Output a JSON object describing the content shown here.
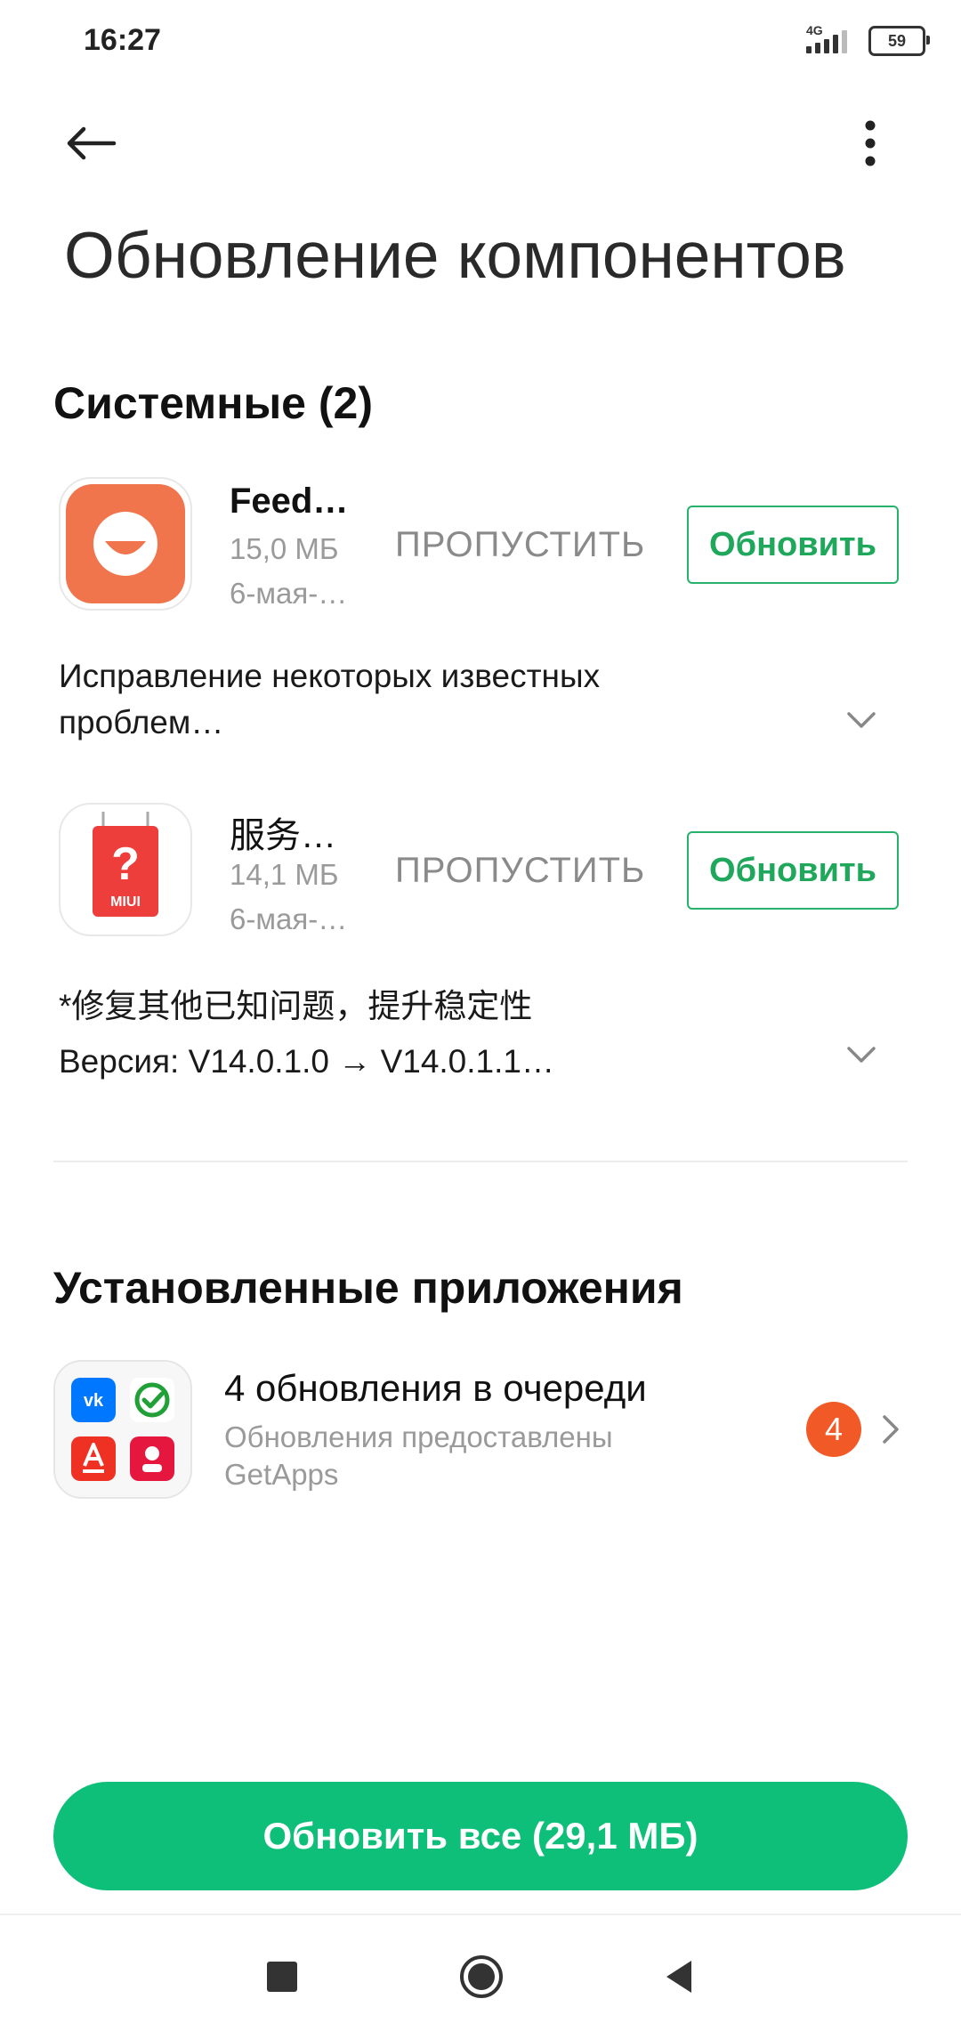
{
  "status_bar": {
    "time": "16:27",
    "network": "4G",
    "battery": "59"
  },
  "header": {
    "title": "Обновление компонентов"
  },
  "system_section": {
    "heading": "Системные (2)",
    "items": [
      {
        "name": "Feed…",
        "size": "15,0 МБ",
        "date": "6-мая-…",
        "skip_label": "ПРОПУСТИТЬ",
        "update_label": "Обновить",
        "description_line1": "Исправление некоторых известных",
        "description_line2": "проблем…",
        "icon": "feed-smile-icon",
        "icon_color": "#F0744C"
      },
      {
        "name": "服务…",
        "size": "14,1 МБ",
        "date": "6-мая-…",
        "skip_label": "ПРОПУСТИТЬ",
        "update_label": "Обновить",
        "description_line1": "*修复其他已知问题，提升稳定性",
        "description_line2": "Версия: V14.0.1.0 → V14.0.1.1…",
        "icon": "miui-service-icon",
        "icon_text": "MIUI",
        "icon_color": "#EE3E3B"
      }
    ]
  },
  "installed_section": {
    "heading": "Установленные приложения",
    "queue_title": "4 обновления в очереди",
    "queue_subtitle": "Обновления предоставлены GetApps",
    "badge_count": "4",
    "mini_icons": [
      "vk-icon",
      "sber-icon",
      "alfa-bank-icon",
      "app-red-icon"
    ]
  },
  "footer": {
    "update_all_label": "Обновить все (29,1 МБ)"
  },
  "colors": {
    "accent": "#0DBF78",
    "button_green": "#1FA75C",
    "badge": "#F15A26"
  }
}
